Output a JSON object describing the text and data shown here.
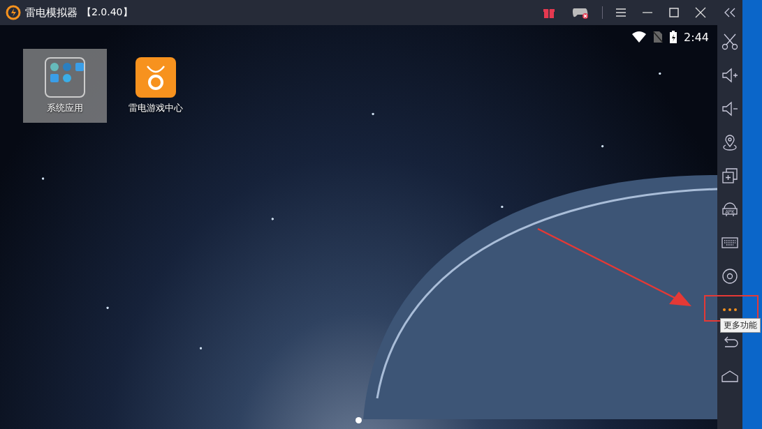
{
  "window": {
    "title": "雷电模拟器",
    "version": "【2.0.40】"
  },
  "status_bar": {
    "time": "2:44"
  },
  "apps": [
    {
      "label": "系统应用",
      "kind": "folder",
      "selected": true
    },
    {
      "label": "雷电游戏中心",
      "kind": "store",
      "selected": false
    }
  ],
  "toolbar": [
    {
      "kind": "scissors"
    },
    {
      "kind": "volume-up"
    },
    {
      "kind": "volume-down"
    },
    {
      "kind": "location"
    },
    {
      "kind": "multi"
    },
    {
      "kind": "apk",
      "label": "APK"
    },
    {
      "kind": "keyboard"
    },
    {
      "kind": "settings"
    },
    {
      "kind": "more",
      "tooltip": "更多功能"
    },
    {
      "kind": "back"
    },
    {
      "kind": "home"
    }
  ],
  "page_dots": [
    {
      "selected": true
    }
  ]
}
